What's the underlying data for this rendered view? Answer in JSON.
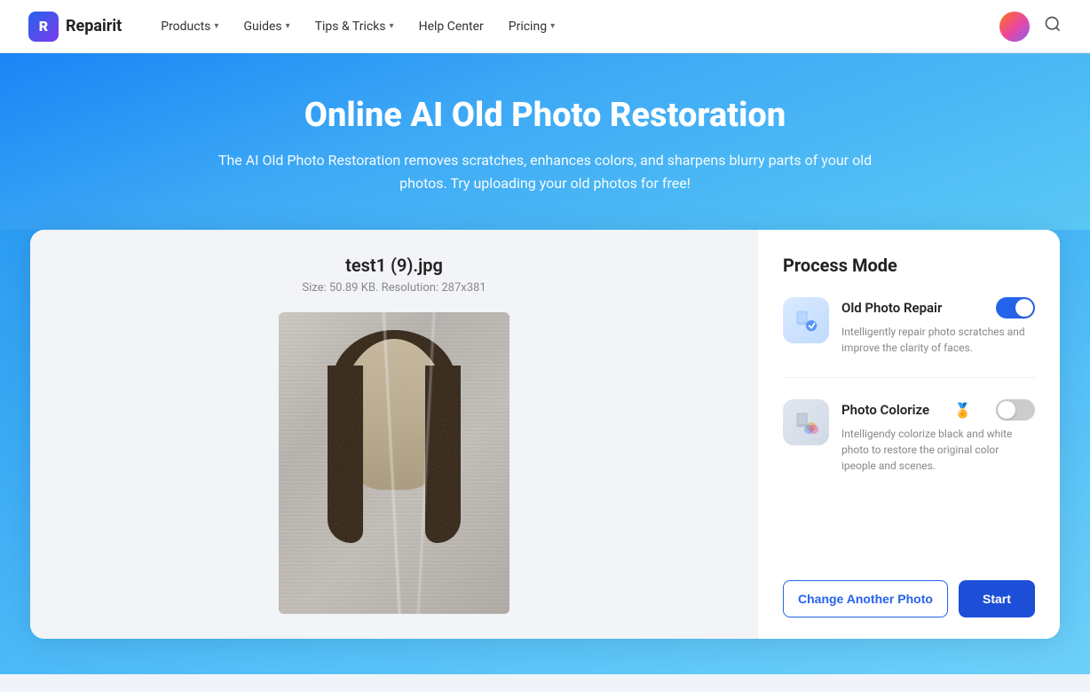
{
  "nav": {
    "brand_name": "Repairit",
    "products_label": "Products",
    "guides_label": "Guides",
    "tips_label": "Tips & Tricks",
    "help_label": "Help Center",
    "pricing_label": "Pricing"
  },
  "hero": {
    "title": "Online AI Old Photo Restoration",
    "subtitle": "The AI Old Photo Restoration removes scratches, enhances colors, and sharpens blurry parts of your old photos. Try uploading your old photos for free!"
  },
  "file": {
    "name": "test1 (9).jpg",
    "meta": "Size: 50.89 KB. Resolution: 287x381"
  },
  "process": {
    "title": "Process Mode",
    "repair_name": "Old Photo Repair",
    "repair_desc": "Intelligently repair photo scratches and improve the clarity of faces.",
    "colorize_name": "Photo Colorize",
    "colorize_desc": "Intelligendy colorize black and white photo to restore the original color ipeople and scenes.",
    "colorize_badge": "🏅",
    "change_photo_label": "Change Another Photo",
    "start_label": "Start"
  }
}
